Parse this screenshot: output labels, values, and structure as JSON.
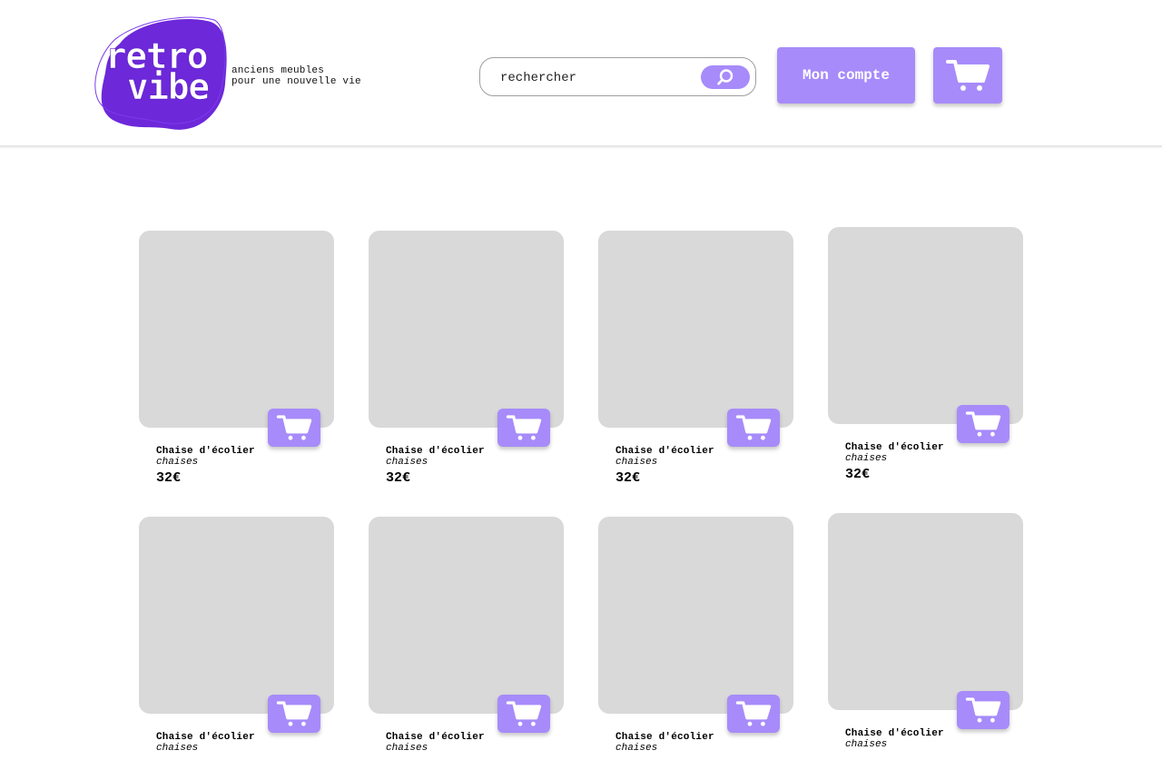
{
  "brand": {
    "logo_line1": "retro",
    "logo_line2": "vibe",
    "tagline_line1": "anciens meubles",
    "tagline_line2": "pour une nouvelle vie"
  },
  "search": {
    "placeholder": "rechercher",
    "button_icon": "search-icon"
  },
  "header": {
    "account_label": "Mon compte",
    "cart_icon": "cart-icon"
  },
  "colors": {
    "accent": "#a78bfa",
    "logo_blob": "#6d28d9",
    "placeholder_image": "#d9d9d9"
  },
  "products": [
    {
      "name": "Chaise d'écolier",
      "category": "chaises",
      "price": "32€"
    },
    {
      "name": "Chaise d'écolier",
      "category": "chaises",
      "price": "32€"
    },
    {
      "name": "Chaise d'écolier",
      "category": "chaises",
      "price": "32€"
    },
    {
      "name": "Chaise d'écolier",
      "category": "chaises",
      "price": "32€"
    },
    {
      "name": "Chaise d'écolier",
      "category": "chaises",
      "price": ""
    },
    {
      "name": "Chaise d'écolier",
      "category": "chaises",
      "price": ""
    },
    {
      "name": "Chaise d'écolier",
      "category": "chaises",
      "price": ""
    },
    {
      "name": "Chaise d'écolier",
      "category": "chaises",
      "price": ""
    }
  ]
}
